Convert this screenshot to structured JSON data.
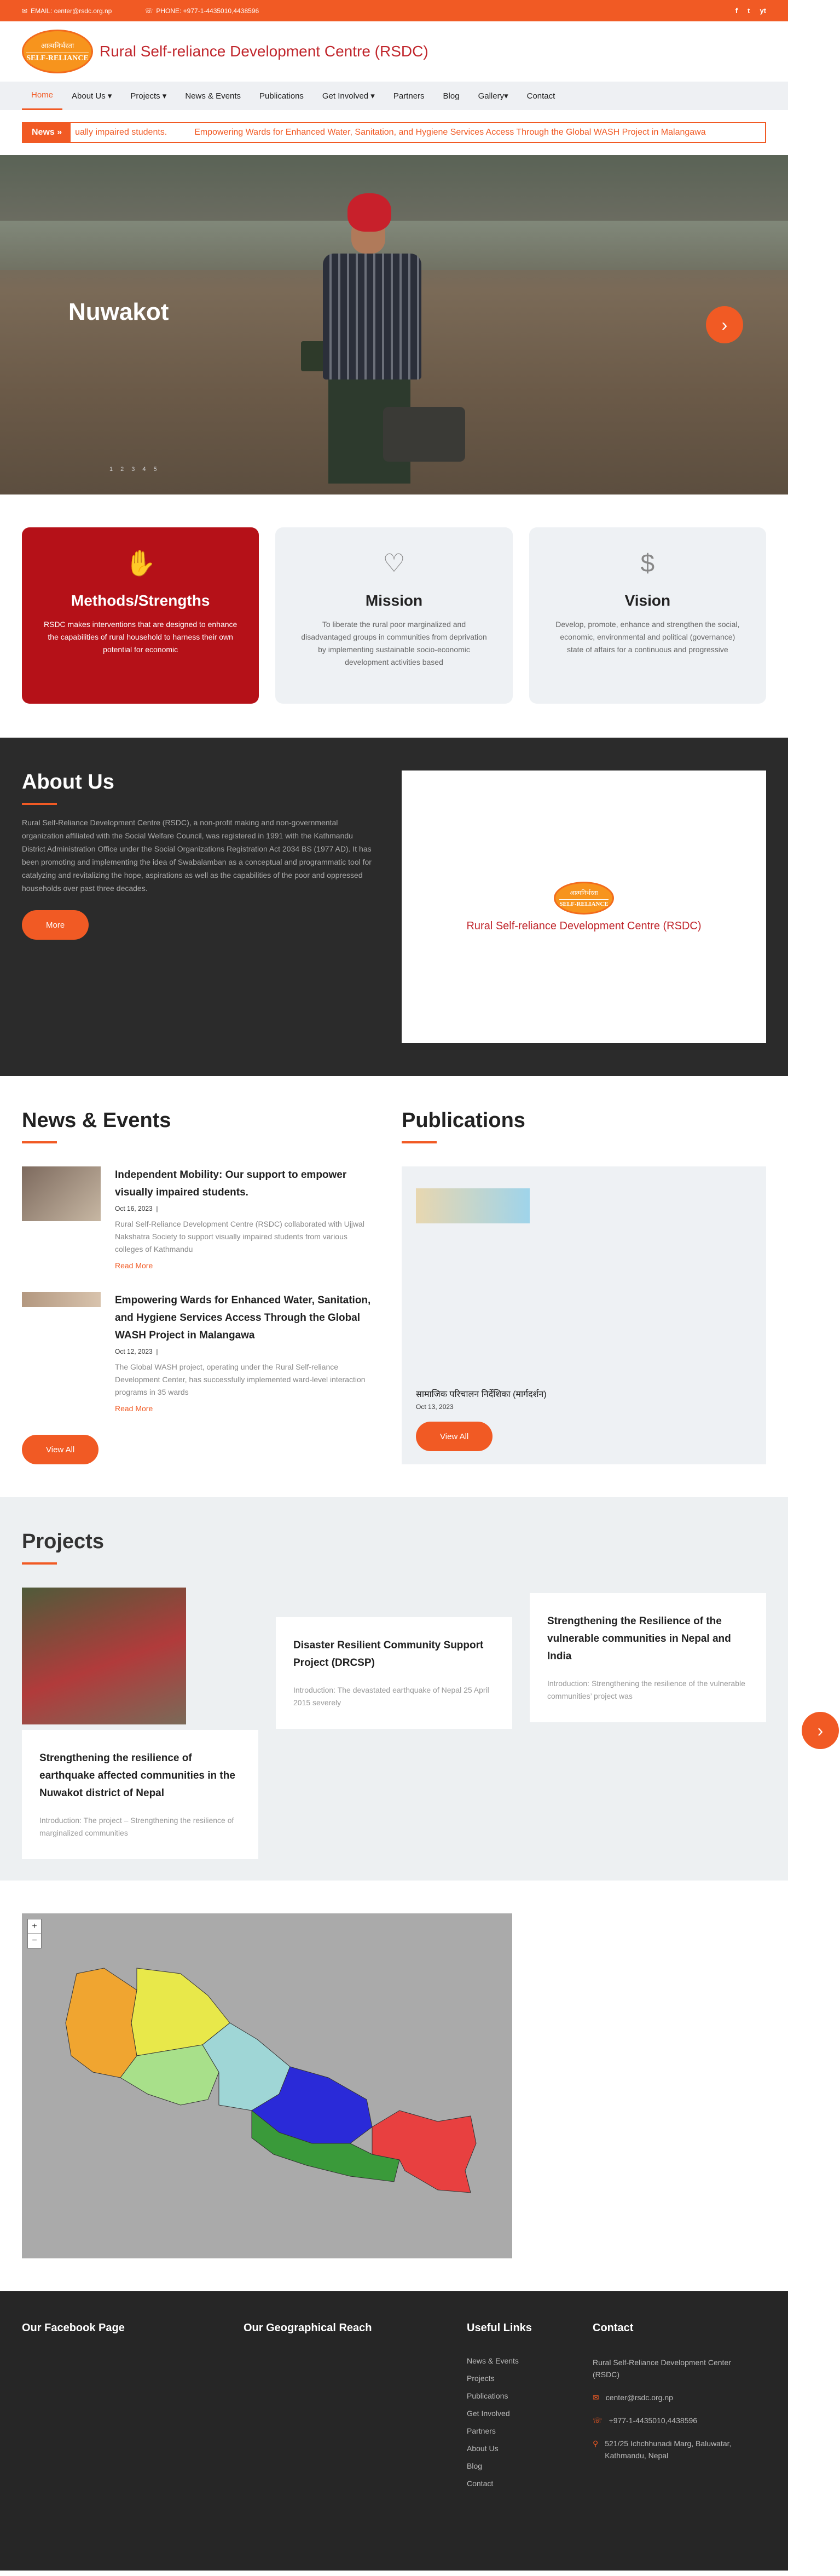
{
  "topbar": {
    "email": "EMAIL: center@rsdc.org.np",
    "phone": "PHONE: +977-1-4435010,4438596",
    "social": [
      "f",
      "t",
      "yt"
    ]
  },
  "header": {
    "logo_line1": "आत्मनिर्भरता",
    "logo_line2": "SELF-RELIANCE",
    "site_title": "Rural Self-reliance Development Centre (RSDC)"
  },
  "nav": [
    "Home",
    "About Us",
    "Projects",
    "News & Events",
    "Publications",
    "Get Involved",
    "Partners",
    "Blog",
    "Gallery",
    "Contact"
  ],
  "ticker": {
    "tag": "News",
    "items": [
      "ually impaired students.",
      "Empowering Wards for Enhanced Water, Sanitation, and Hygiene Services Access Through the Global WASH Project in Malangawa"
    ]
  },
  "hero": {
    "caption": "Nuwakot",
    "dots": [
      "1",
      "2",
      "3",
      "4",
      "5"
    ]
  },
  "cards": [
    {
      "title": "Methods/Strengths",
      "text": "RSDC makes interventions that are designed to enhance the capabilities of rural household to harness their own potential for economic",
      "icon": "hands-icon"
    },
    {
      "title": "Mission",
      "text": "To liberate the rural poor marginalized and disadvantaged groups in communities from deprivation by implementing sustainable socio-economic development activities based",
      "icon": "heart-hand-icon"
    },
    {
      "title": "Vision",
      "text": "Develop, promote, enhance and strengthen the social, economic, environmental and political (governance) state of affairs for a continuous and progressive",
      "icon": "piggy-bank-icon"
    }
  ],
  "about": {
    "title": "About Us",
    "text": "Rural Self-Reliance Development Centre (RSDC), a non-profit making and non-governmental organization affiliated with the Social Welfare Council, was registered in 1991 with the Kathmandu District Administration Office under the Social Organizations Registration Act 2034 BS (1977 AD). It has been promoting and implementing the idea of Swabalamban as a conceptual and programmatic tool for catalyzing and revitalizing the hope, aspirations as well as the capabilities of the poor and oppressed households over past three decades.",
    "button": "More",
    "logo_title": "Rural Self-reliance Development Centre (RSDC)"
  },
  "news": {
    "title": "News & Events",
    "items": [
      {
        "title": "Independent Mobility: Our support to empower visually impaired students.",
        "date": "Oct 16, 2023",
        "sep": "|",
        "body": "Rural Self-Reliance Development Centre (RSDC) collaborated with Ujjwal Nakshatra Society to support visually impaired students from various colleges of Kathmandu",
        "more": "Read More"
      },
      {
        "title": "Empowering Wards for Enhanced Water, Sanitation, and Hygiene Services Access Through the Global WASH Project in Malangawa",
        "date": "Oct 12, 2023",
        "sep": "|",
        "body": "The Global WASH project, operating under the Rural Self-reliance Development Center, has successfully implemented ward-level interaction programs in 35 wards",
        "more": "Read More"
      }
    ],
    "button": "View All"
  },
  "publications": {
    "title": "Publications",
    "item_title": "सामाजिक परिचालन निर्देशिका (मार्गदर्शन)",
    "item_date": "Oct 13, 2023",
    "button": "View All"
  },
  "projects": {
    "title": "Projects",
    "items": [
      {
        "title": "Disaster Resilient Community Support Project (DRCSP)",
        "intro": "Introduction: The devastated earthquake of Nepal 25 April 2015 severely"
      },
      {
        "title": "Strengthening the Resilience of the vulnerable communities in Nepal and India",
        "intro": "Introduction: Strengthening the resilience of the vulnerable communities’ project was"
      },
      {
        "title": "Strengthening the resilience of earthquake affected communities in the Nuwakot district of Nepal",
        "intro": "Introduction: The project – Strengthening the resilience of marginalized communities"
      }
    ]
  },
  "map": {
    "zoom_in": "+",
    "zoom_out": "−",
    "regions": [
      {
        "color": "#f0a530"
      },
      {
        "color": "#e8e84a"
      },
      {
        "color": "#a8e08a"
      },
      {
        "color": "#9fd6d6"
      },
      {
        "color": "#2a2ad8"
      },
      {
        "color": "#3a9a3a"
      },
      {
        "color": "#e84040"
      }
    ]
  },
  "footer": {
    "col1": "Our Facebook Page",
    "col2": "Our Geographical Reach",
    "col3": "Useful Links",
    "links": [
      "News & Events",
      "Projects",
      "Publications",
      "Get Involved",
      "Partners",
      "About Us",
      "Blog",
      "Contact"
    ],
    "col4": "Contact",
    "org": "Rural Self-Reliance Development Center (RSDC)",
    "email": "center@rsdc.org.np",
    "phone": "+977-1-4435010,4438596",
    "address": "521/25 Ichchhunadi Marg, Baluwatar, Kathmandu, Nepal"
  },
  "colors": {
    "accent": "#f15a24",
    "brand_red": "#c1272d",
    "dark": "#2b2b2b"
  }
}
